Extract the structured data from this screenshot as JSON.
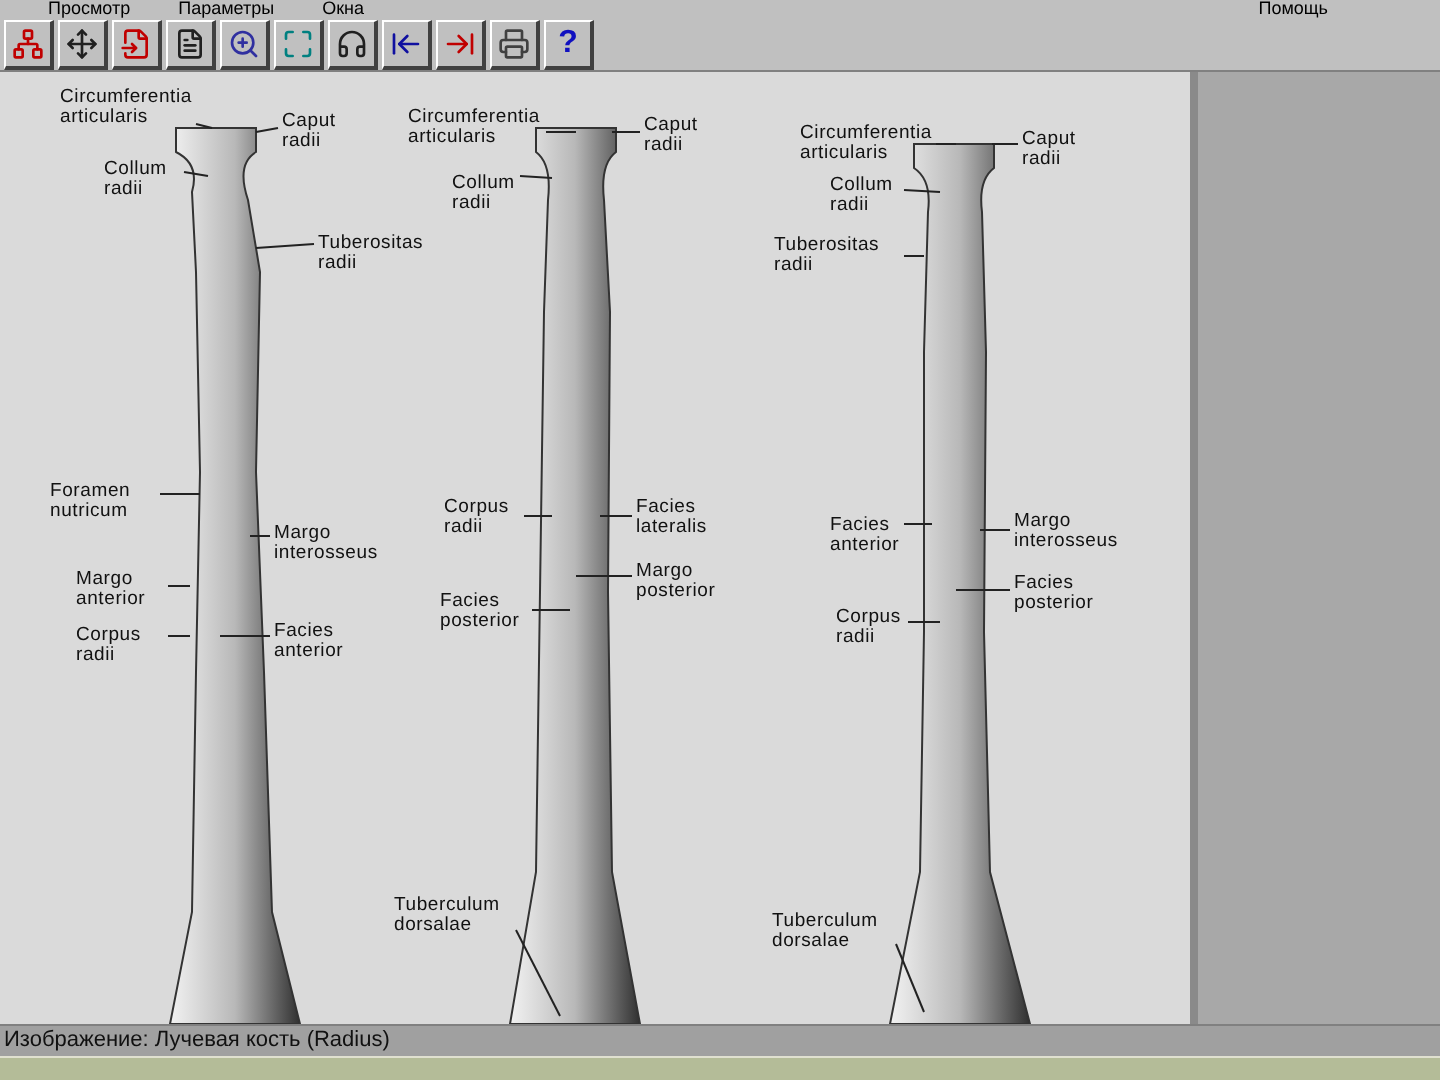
{
  "menu": [
    "Просмотр",
    "Параметры",
    "Окна",
    "Помощь"
  ],
  "toolbar": [
    {
      "kind": "hierarchy"
    },
    {
      "kind": "move"
    },
    {
      "kind": "import"
    },
    {
      "kind": "document"
    },
    {
      "kind": "zoom"
    },
    {
      "kind": "fit"
    },
    {
      "kind": "audio"
    },
    {
      "kind": "back"
    },
    {
      "kind": "forward"
    },
    {
      "kind": "print"
    },
    {
      "kind": "help",
      "label": "?"
    }
  ],
  "views": [
    {
      "labels": [
        "Circumferentia articularis",
        "Caput radii",
        "Collum radii",
        "Tuberositas radii",
        "Foramen nutricum",
        "Margo interosseus",
        "Margo anterior",
        "Corpus radii",
        "Facies anterior"
      ]
    },
    {
      "labels": [
        "Circumferentia articularis",
        "Caput radii",
        "Collum radii",
        "Corpus radii",
        "Facies lateralis",
        "Margo posterior",
        "Facies posterior",
        "Tuberculum dorsalae"
      ]
    },
    {
      "labels": [
        "Circumferentia articularis",
        "Caput radii",
        "Collum radii",
        "Tuberositas radii",
        "Facies anterior",
        "Margo interosseus",
        "Facies posterior",
        "Corpus radii",
        "Tuberculum dorsalae"
      ]
    }
  ],
  "status_bar": "Изображение: Лучевая кость (Radius)"
}
